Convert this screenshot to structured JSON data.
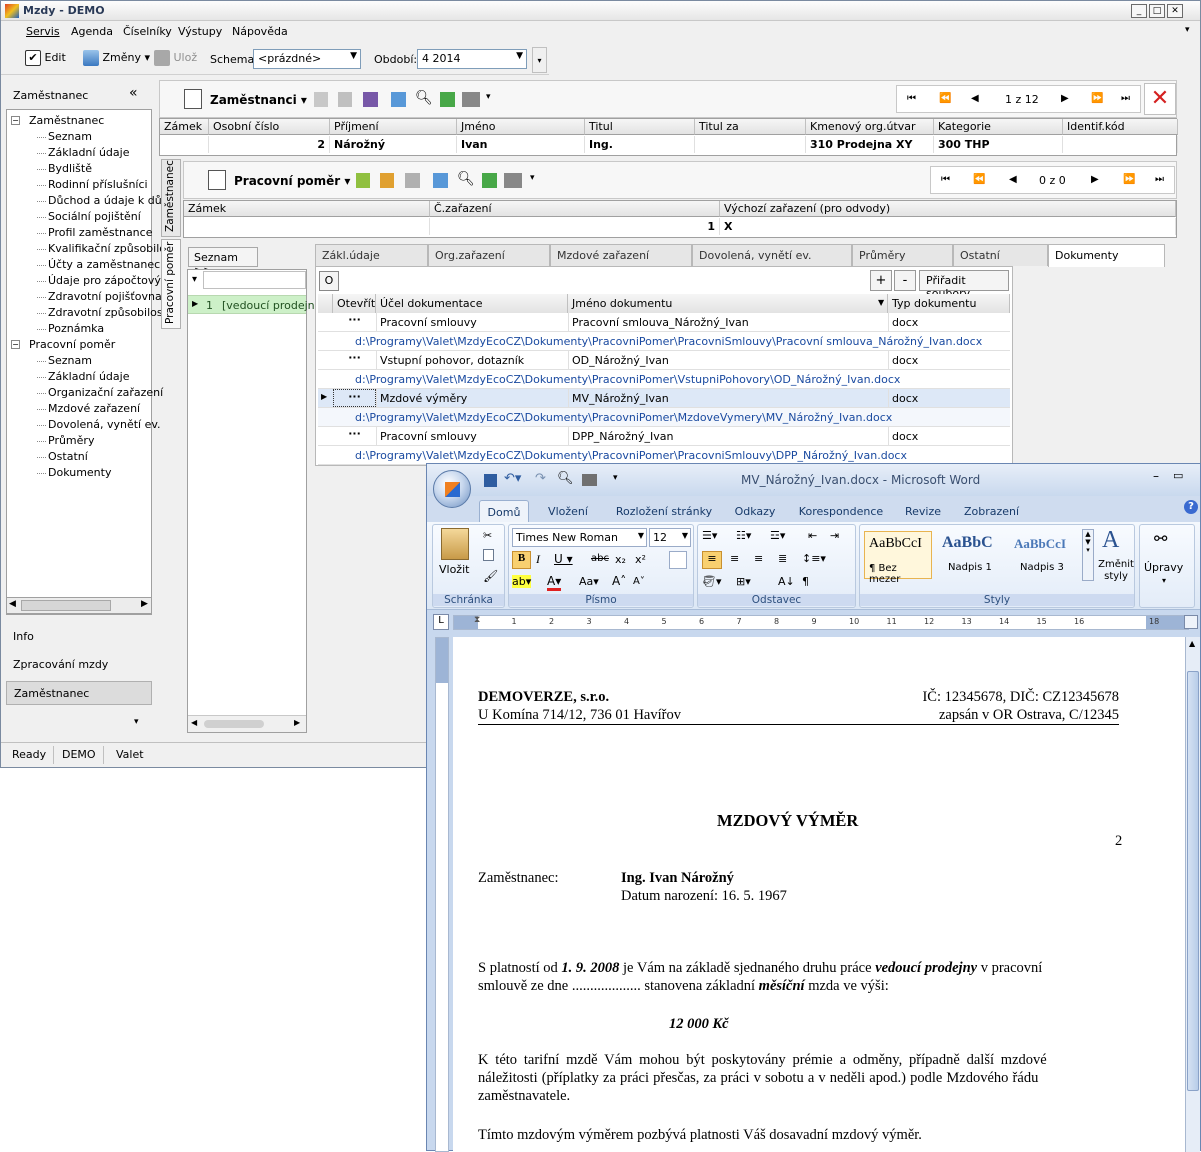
{
  "app": {
    "title": "Mzdy - DEMO",
    "menu": [
      "Servis",
      "Agenda",
      "Číselníky",
      "Výstupy",
      "Nápověda"
    ],
    "toolbar": {
      "edit": "Edit",
      "changes": "Změny",
      "save": "Ulož",
      "schema_label": "Schema",
      "schema_value": "<prázdné>",
      "period_label": "Období:",
      "period_value": "4  2014"
    },
    "left_panel": {
      "header": "Zaměstnanec",
      "tree": [
        {
          "label": "Zaměstnanec",
          "level": 0
        },
        {
          "label": "Seznam",
          "level": 1
        },
        {
          "label": "Základní údaje",
          "level": 1
        },
        {
          "label": "Bydliště",
          "level": 1
        },
        {
          "label": "Rodinní příslušníci",
          "level": 1
        },
        {
          "label": "Důchod a údaje k důc",
          "level": 1
        },
        {
          "label": "Sociální pojištění",
          "level": 1
        },
        {
          "label": "Profil zaměstnance",
          "level": 1
        },
        {
          "label": "Kvalifikační způsobilos",
          "level": 1
        },
        {
          "label": "Účty a zaměstnaneck",
          "level": 1
        },
        {
          "label": "Údaje pro zápočtový",
          "level": 1
        },
        {
          "label": "Zdravotní pojišťovna",
          "level": 1
        },
        {
          "label": "Zdravotní způsobilost",
          "level": 1
        },
        {
          "label": "Poznámka",
          "level": 1
        },
        {
          "label": "Pracovní poměr",
          "level": 0
        },
        {
          "label": "Seznam",
          "level": 1
        },
        {
          "label": "Základní údaje",
          "level": 1
        },
        {
          "label": "Organizační zařazení",
          "level": 1
        },
        {
          "label": "Mzdové zařazení",
          "level": 1
        },
        {
          "label": "Dovolená, vynětí ev.",
          "level": 1
        },
        {
          "label": "Průměry",
          "level": 1
        },
        {
          "label": "Ostatní",
          "level": 1
        },
        {
          "label": "Dokumenty",
          "level": 1
        }
      ],
      "nav_buttons": [
        "Info",
        "Zpracování mzdy",
        "Zaměstnanec"
      ]
    },
    "status": [
      "Ready",
      "DEMO",
      "Valet"
    ],
    "employees": {
      "title": "Zaměstnanci",
      "nav_counter": "1 z 12",
      "columns": [
        "Zámek",
        "Osobní číslo",
        "Příjmení",
        "Jméno",
        "Titul",
        "Titul za",
        "Kmenový org.útvar",
        "Kategorie",
        "Identif.kód"
      ],
      "row": [
        "",
        "2",
        "Nárožný",
        "Ivan",
        "Ing.",
        "",
        "310  Prodejna XY",
        "300  THP",
        ""
      ]
    },
    "side_tabs": [
      "Zaměstnanec",
      "Pracovní poměr"
    ],
    "employment": {
      "title": "Pracovní poměr",
      "nav_counter": "0 z 0",
      "columns": [
        "Zámek",
        "Č.zařazení",
        "Výchozí zařazení (pro odvody)"
      ],
      "row": [
        "",
        "1",
        "X"
      ]
    },
    "list": {
      "button": "Seznam >>",
      "filter_icon": "▾",
      "item_num": "1",
      "item": "[vedoucí prodejny"
    },
    "detail_tabs": [
      "Zákl.údaje",
      "Org.zařazení",
      "Mzdové zařazení",
      "Dovolená, vynětí ev.",
      "Průměry",
      "Ostatní",
      "Dokumenty"
    ],
    "documents": {
      "o_button": "O",
      "plus": "+",
      "minus": "-",
      "assign": "Přiřadit soubory",
      "columns": [
        "Otevřít",
        "Účel dokumentace",
        "Jméno dokumentu",
        "Typ dokumentu"
      ],
      "open_glyph": "···",
      "rows": [
        {
          "purpose": "Pracovní smlouvy",
          "name": "Pracovní smlouva_Nárožný_Ivan",
          "type": "docx",
          "path": "d:\\Programy\\Valet\\MzdyEcoCZ\\Dokumenty\\PracovniPomer\\PracovniSmlouvy\\Pracovní smlouva_Nárožný_Ivan.docx"
        },
        {
          "purpose": "Vstupní pohovor, dotazník",
          "name": "OD_Nárožný_Ivan",
          "type": "docx",
          "path": "d:\\Programy\\Valet\\MzdyEcoCZ\\Dokumenty\\PracovniPomer\\VstupniPohovory\\OD_Nárožný_Ivan.docx"
        },
        {
          "purpose": "Mzdové výměry",
          "name": "MV_Nárožný_Ivan",
          "type": "docx",
          "path": "d:\\Programy\\Valet\\MzdyEcoCZ\\Dokumenty\\PracovniPomer\\MzdoveVymery\\MV_Nárožný_Ivan.docx"
        },
        {
          "purpose": "Pracovní smlouvy",
          "name": "DPP_Nárožný_Ivan",
          "type": "docx",
          "path": "d:\\Programy\\Valet\\MzdyEcoCZ\\Dokumenty\\PracovniPomer\\PracovniSmlouvy\\DPP_Nárožný_Ivan.docx"
        }
      ]
    }
  },
  "word": {
    "title": "MV_Nárožný_Ivan.docx - Microsoft Word",
    "tabs": [
      "Domů",
      "Vložení",
      "Rozložení stránky",
      "Odkazy",
      "Korespondence",
      "Revize",
      "Zobrazení"
    ],
    "groups": {
      "clipboard": "Schránka",
      "paste": "Vložit",
      "font": "Písmo",
      "font_name": "Times New Roman",
      "font_size": "12",
      "paragraph": "Odstavec",
      "styles": "Styly",
      "style_preview": [
        "AaBbCcI",
        "AaBbC",
        "AaBbCcI"
      ],
      "style_names": [
        "¶ Bez mezer",
        "Nadpis 1",
        "Nadpis 3"
      ],
      "change_styles": "Změnit styly",
      "editing": "Úpravy"
    },
    "ruler_numbers": [
      "1",
      "2",
      "3",
      "4",
      "5",
      "6",
      "7",
      "8",
      "9",
      "10",
      "11",
      "12",
      "13",
      "14",
      "15",
      "16",
      "18"
    ],
    "doc": {
      "company": "DEMOVERZE, s.r.o.",
      "ids": "IČ: 12345678, DIČ: CZ12345678",
      "address": "U Komína 714/12, 736 01 Havířov",
      "registry": "zapsán v OR Ostrava, C/12345",
      "heading": "MZDOVÝ VÝMĚR",
      "number": "2",
      "employee_label": "Zaměstnanec:",
      "employee_name": "Ing. Ivan Nárožný",
      "birth": "Datum narození: 16. 5. 1967",
      "p1_a": "S platností od ",
      "p1_date": "1. 9. 2008",
      "p1_b": "  je Vám na základě sjednaného druhu práce ",
      "p1_job": "vedoucí prodejny",
      "p1_c": " v pracovní",
      "p1_line2_a": "smlouvě ze dne ................... stanovena základní ",
      "p1_monthly": "měsíční",
      "p1_line2_b": " mzda ve výši:",
      "amount": "12 000 Kč",
      "p2_l1": "K této tarifní mzdě Vám mohou být poskytovány prémie a odměny, případně další mzdové",
      "p2_l2": "náležitosti (příplatky za práci přesčas, za práci v sobotu a v neděli apod.) podle Mzdového řádu",
      "p2_l3": "zaměstnavatele.",
      "p3": "Tímto mzdovým výměrem pozbývá platnosti Váš dosavadní mzdový výměr."
    }
  },
  "colors": {
    "accent_blue": "#1a4aa0",
    "close_red": "#d42020",
    "selection": "#dde8f7",
    "list_green": "#cdf0c8"
  }
}
